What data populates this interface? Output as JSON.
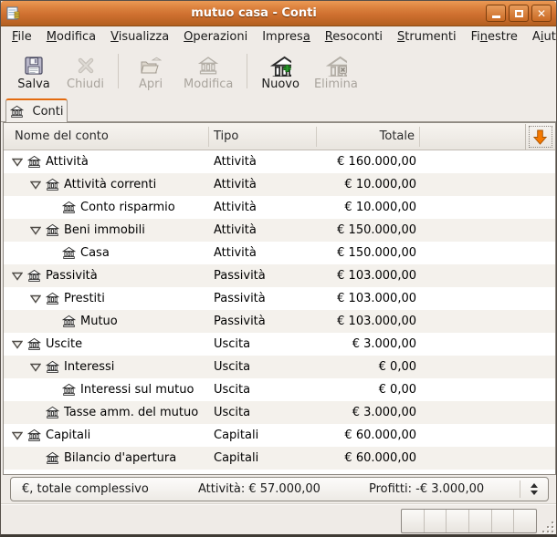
{
  "window": {
    "title": "mutuo casa - Conti"
  },
  "menu": {
    "items": [
      {
        "pre": "",
        "key": "F",
        "post": "ile"
      },
      {
        "pre": "",
        "key": "M",
        "post": "odifica"
      },
      {
        "pre": "",
        "key": "V",
        "post": "isualizza"
      },
      {
        "pre": "",
        "key": "O",
        "post": "perazioni"
      },
      {
        "pre": "Impres",
        "key": "a",
        "post": ""
      },
      {
        "pre": "",
        "key": "R",
        "post": "esoconti"
      },
      {
        "pre": "",
        "key": "S",
        "post": "trumenti"
      },
      {
        "pre": "Fi",
        "key": "n",
        "post": "estre"
      },
      {
        "pre": "A",
        "key": "i",
        "post": "uto"
      }
    ]
  },
  "toolbar": {
    "save": "Salva",
    "close": "Chiudi",
    "open": "Apri",
    "edit": "Modifica",
    "new": "Nuovo",
    "delete": "Elimina"
  },
  "tabs": {
    "active": "Conti"
  },
  "table": {
    "headers": {
      "name": "Nome del conto",
      "type": "Tipo",
      "total": "Totale"
    },
    "rows": [
      {
        "name": "Attività",
        "type": "Attività",
        "total": "€ 160.000,00"
      },
      {
        "name": "Attività correnti",
        "type": "Attività",
        "total": "€ 10.000,00"
      },
      {
        "name": "Conto risparmio",
        "type": "Attività",
        "total": "€ 10.000,00"
      },
      {
        "name": "Beni immobili",
        "type": "Attività",
        "total": "€ 150.000,00"
      },
      {
        "name": "Casa",
        "type": "Attività",
        "total": "€ 150.000,00"
      },
      {
        "name": "Passività",
        "type": "Passività",
        "total": "€ 103.000,00"
      },
      {
        "name": "Prestiti",
        "type": "Passività",
        "total": "€ 103.000,00"
      },
      {
        "name": "Mutuo",
        "type": "Passività",
        "total": "€ 103.000,00"
      },
      {
        "name": "Uscite",
        "type": "Uscita",
        "total": "€ 3.000,00"
      },
      {
        "name": "Interessi",
        "type": "Uscita",
        "total": "€ 0,00"
      },
      {
        "name": "Interessi sul mutuo",
        "type": "Uscita",
        "total": "€ 0,00"
      },
      {
        "name": "Tasse amm. del mutuo",
        "type": "Uscita",
        "total": "€ 3.000,00"
      },
      {
        "name": "Capitali",
        "type": "Capitali",
        "total": "€ 60.000,00"
      },
      {
        "name": "Bilancio d'apertura",
        "type": "Capitali",
        "total": "€ 60.000,00"
      }
    ]
  },
  "summary": {
    "scope": "€, totale complessivo",
    "assets": "Attività: € 57.000,00",
    "profits": "Profitti: -€ 3.000,00"
  },
  "colors": {
    "accent_orange": "#f57900",
    "titlebar_top": "#e78a42",
    "titlebar_bottom": "#b05c1e",
    "row_alt": "#f4f1ec",
    "new_badge_green": "#2e9d33"
  }
}
